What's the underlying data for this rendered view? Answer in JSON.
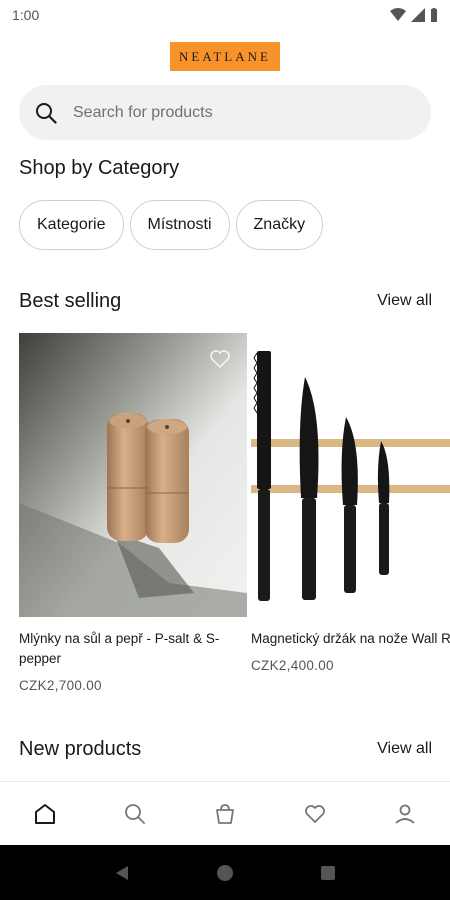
{
  "status": {
    "time": "1:00"
  },
  "brand": {
    "name": "NEATLANE"
  },
  "search": {
    "placeholder": "Search for products",
    "icon": "search-icon"
  },
  "shop_by_category": {
    "title": "Shop by Category",
    "chips": [
      "Kategorie",
      "Místnosti",
      "Značky"
    ]
  },
  "best_selling": {
    "title": "Best selling",
    "view_all": "View all",
    "products": [
      {
        "name": "Mlýnky na sůl a pepř - P-salt & S-pepper",
        "price": "CZK2,700.00"
      },
      {
        "name": "Magnetický držák na nože Wall Rack",
        "price": "CZK2,400.00"
      }
    ]
  },
  "new_products": {
    "title": "New products",
    "view_all": "View all"
  },
  "tabbar": {
    "items": [
      "home-icon",
      "search-icon",
      "bag-icon",
      "heart-icon",
      "profile-icon"
    ],
    "active_index": 0
  },
  "colors": {
    "brand": "#f7932a",
    "search_bg": "#f1f1f1",
    "nav_bar": "#000000"
  }
}
